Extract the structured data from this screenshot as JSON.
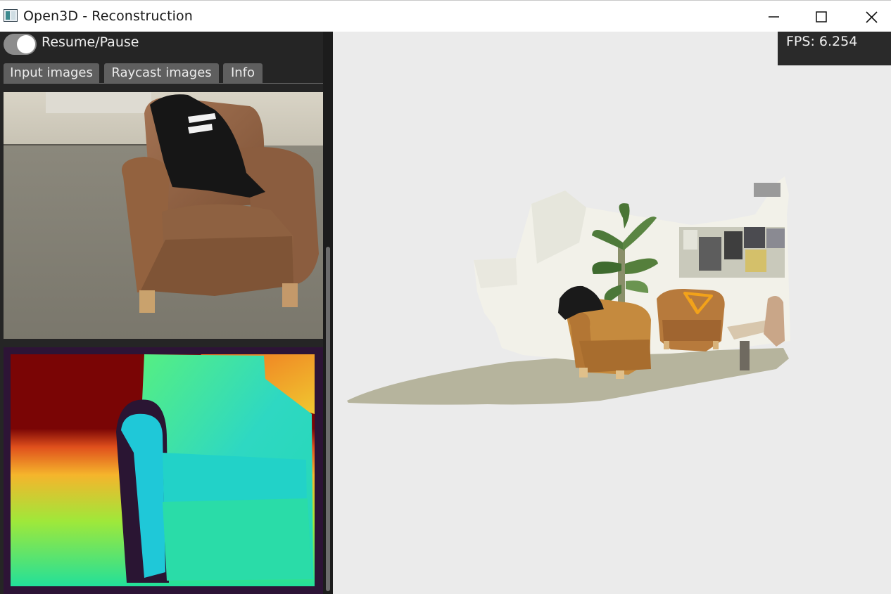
{
  "window": {
    "title": "Open3D - Reconstruction",
    "controls": {
      "minimize": "minimize-icon",
      "maximize": "maximize-icon",
      "close": "close-icon"
    }
  },
  "left_panel": {
    "toggle_label": "Resume/Pause",
    "toggle_on": true,
    "tabs": [
      {
        "label": "Input images",
        "selected": true
      },
      {
        "label": "Raycast images",
        "selected": false
      },
      {
        "label": "Info",
        "selected": false
      }
    ],
    "images": [
      {
        "kind": "color image of a leather armchair"
      },
      {
        "kind": "depth image (colormap)"
      }
    ]
  },
  "viewport": {
    "fps_label": "FPS: 6.254",
    "camera_marker_color": "#f2a21a",
    "background_color": "#ebebeb"
  },
  "colors": {
    "panel_bg": "#252525",
    "tab_bg": "#5f5f5f",
    "toggle_bg": "#8c8c8c"
  }
}
